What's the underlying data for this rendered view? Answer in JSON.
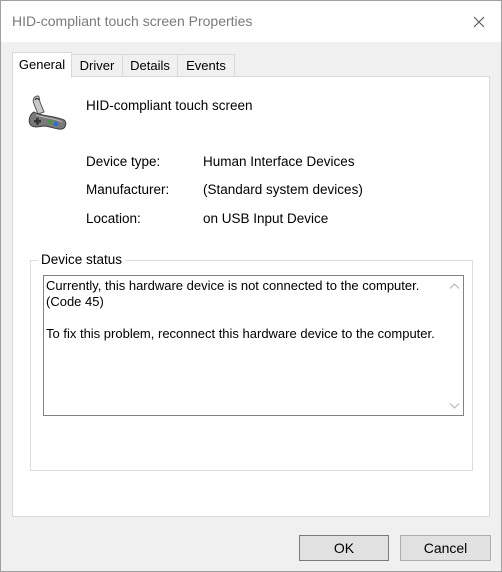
{
  "window": {
    "title": "HID-compliant touch screen Properties"
  },
  "tabs": [
    {
      "label": "General",
      "active": true
    },
    {
      "label": "Driver",
      "active": false
    },
    {
      "label": "Details",
      "active": false
    },
    {
      "label": "Events",
      "active": false
    }
  ],
  "device": {
    "icon": "game-controller-icon",
    "name": "HID-compliant touch screen",
    "properties": [
      {
        "label": "Device type:",
        "value": "Human Interface Devices"
      },
      {
        "label": "Manufacturer:",
        "value": "(Standard system devices)"
      },
      {
        "label": "Location:",
        "value": "on USB Input Device"
      }
    ]
  },
  "status": {
    "group_title": "Device status",
    "text": "Currently, this hardware device is not connected to the computer. (Code 45)\n\nTo fix this problem, reconnect this hardware device to the computer."
  },
  "buttons": {
    "ok": "OK",
    "cancel": "Cancel"
  },
  "colors": {
    "title_text": "#7a7a7a",
    "dialog_bg": "#f0f0f0",
    "button_bg": "#e1e1e1"
  }
}
